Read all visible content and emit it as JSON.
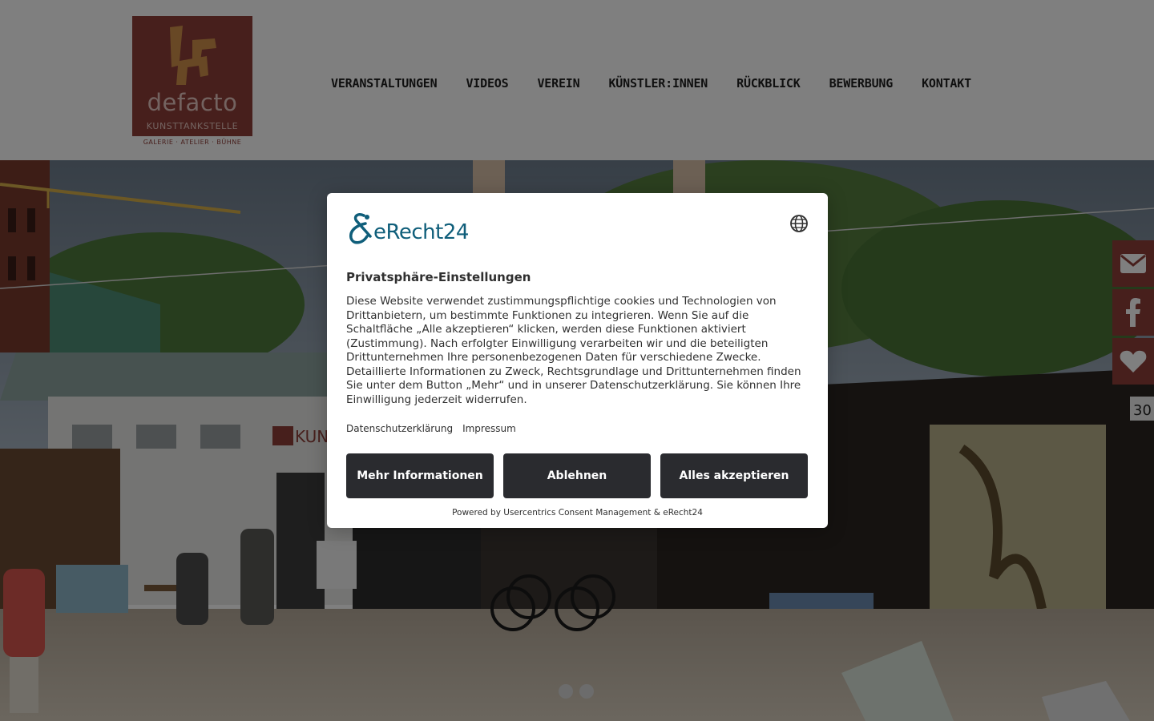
{
  "header": {
    "logo": {
      "name": "defacto",
      "subtitle": "KUNSTTANKSTELLE",
      "tagline": "GALERIE · ATELIER · BÜHNE"
    },
    "nav": [
      {
        "label": "VERANSTALTUNGEN"
      },
      {
        "label": "VIDEOS"
      },
      {
        "label": "VEREIN"
      },
      {
        "label": "KÜNSTLER:INNEN"
      },
      {
        "label": "RÜCKBLICK"
      },
      {
        "label": "BEWERBUNG"
      },
      {
        "label": "KONTAKT"
      }
    ]
  },
  "hero": {
    "slides_count": 2,
    "active_slide": 1,
    "sign_text": "KUN",
    "building_number": "30"
  },
  "social": [
    {
      "icon": "envelope-icon"
    },
    {
      "icon": "facebook-icon"
    },
    {
      "icon": "heart-icon"
    }
  ],
  "consent": {
    "brand": "eRecht24",
    "title": "Privatsphäre-Einstellungen",
    "text": "Diese Website verwendet zustimmungspflichtige cookies und Technologien von Drittanbietern, um bestimmte Funktionen zu integrieren. Wenn Sie auf die Schaltfläche „Alle akzeptieren“ klicken, werden diese Funktionen aktiviert (Zustimmung). Nach erfolgter Einwilligung verarbeiten wir und die beteiligten Drittunternehmen Ihre personenbezogenen Daten für verschiedene Zwecke. Detaillierte Informationen zu Zweck, Rechtsgrundlage und Drittunternehmen finden Sie unter dem Button „Mehr“ und in unserer Datenschutzerklärung. Sie können Ihre Einwilligung jederzeit widerrufen.",
    "links": {
      "privacy": "Datenschutzerklärung",
      "imprint": "Impressum"
    },
    "buttons": {
      "more": "Mehr Informationen",
      "deny": "Ablehnen",
      "accept": "Alles akzeptieren"
    },
    "powered_by": "Powered by Usercentrics Consent Management & eRecht24"
  },
  "colors": {
    "brand": "#8f3e38",
    "button_dark": "#2a2b2f",
    "erecht_blue": "#0f5e7a",
    "overlay": "rgba(0,0,0,0.5)"
  }
}
